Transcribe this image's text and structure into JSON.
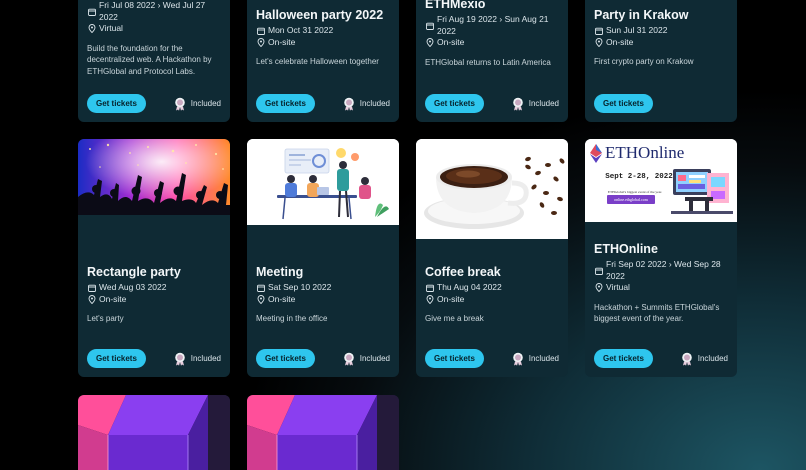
{
  "events": [
    {
      "title": "",
      "dates": "Fri Jul 08 2022 › Wed Jul 27 2022",
      "location": "Virtual",
      "description": "Build the foundation for the decentralized web. A Hackathon by ETHGlobal and Protocol Labs.",
      "button": "Get tickets",
      "badge": "Included"
    },
    {
      "title": "Halloween party 2022",
      "dates": "Mon Oct 31 2022",
      "location": "On-site",
      "description": "Let's celebrate Halloween together",
      "button": "Get tickets",
      "badge": "Included"
    },
    {
      "title": "ETHMexio",
      "dates": "Fri Aug 19 2022 › Sun Aug 21 2022",
      "location": "On-site",
      "description": "ETHGlobal returns to Latin America",
      "button": "Get tickets",
      "badge": "Included"
    },
    {
      "title": "Party in Krakow",
      "dates": "Sun Jul 31 2022",
      "location": "On-site",
      "description": "First crypto party on Krakow",
      "button": "Get tickets",
      "badge": ""
    },
    {
      "title": "Rectangle party",
      "dates": "Wed Aug 03 2022",
      "location": "On-site",
      "description": "Let's party",
      "button": "Get tickets",
      "badge": "Included"
    },
    {
      "title": "Meeting",
      "dates": "Sat Sep 10 2022",
      "location": "On-site",
      "description": "Meeting in the office",
      "button": "Get tickets",
      "badge": "Included"
    },
    {
      "title": "Coffee break",
      "dates": "Thu Aug 04 2022",
      "location": "On-site",
      "description": "Give me a break",
      "button": "Get tickets",
      "badge": "Included"
    },
    {
      "title": "ETHOnline",
      "dates": "Fri Sep 02 2022 › Wed Sep 28 2022",
      "location": "Virtual",
      "description": "Hackathon + Summits ETHGlobal's biggest event of the year.",
      "button": "Get tickets",
      "badge": "Included"
    }
  ],
  "ethonline_banner": {
    "brand": "ETHOnline",
    "dates": "Sept 2-28, 2022",
    "tagline": "ETHGlobal's biggest event of the year.",
    "url": "online.ethglobal.com"
  },
  "colors": {
    "accent": "#2ec6ee",
    "card": "#0f2a34"
  },
  "icons": {
    "date": "calendar-icon",
    "location": "map-pin-icon",
    "badge": "ticket-badge-icon"
  }
}
